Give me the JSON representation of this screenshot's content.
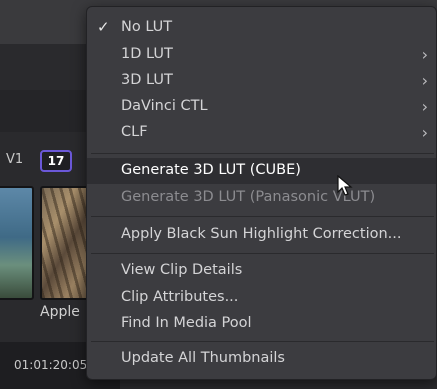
{
  "background": {
    "track_label": "V1",
    "clip_count": "17",
    "clip_name": "Apple",
    "timecode": "01:01:20:05"
  },
  "menu": {
    "items": [
      {
        "label": "No LUT",
        "checked": true,
        "submenu": false
      },
      {
        "label": "1D LUT",
        "submenu": true
      },
      {
        "label": "3D LUT",
        "submenu": true
      },
      {
        "label": "DaVinci CTL",
        "submenu": true
      },
      {
        "label": "CLF",
        "submenu": true
      },
      {
        "label": "Generate 3D LUT (CUBE)",
        "hovered": true
      },
      {
        "label": "Generate 3D LUT (Panasonic VLUT)",
        "disabled": true
      },
      {
        "label": "Apply Black Sun Highlight Correction..."
      },
      {
        "label": "View Clip Details"
      },
      {
        "label": "Clip Attributes..."
      },
      {
        "label": "Find In Media Pool"
      },
      {
        "label": "Update All Thumbnails"
      }
    ],
    "check_glyph": "✓",
    "chevron_glyph": "›"
  },
  "colors": {
    "menu_bg": "#3c3c40",
    "hover_bg": "#2e2e32",
    "clip_count_border": "#6b58d8"
  }
}
